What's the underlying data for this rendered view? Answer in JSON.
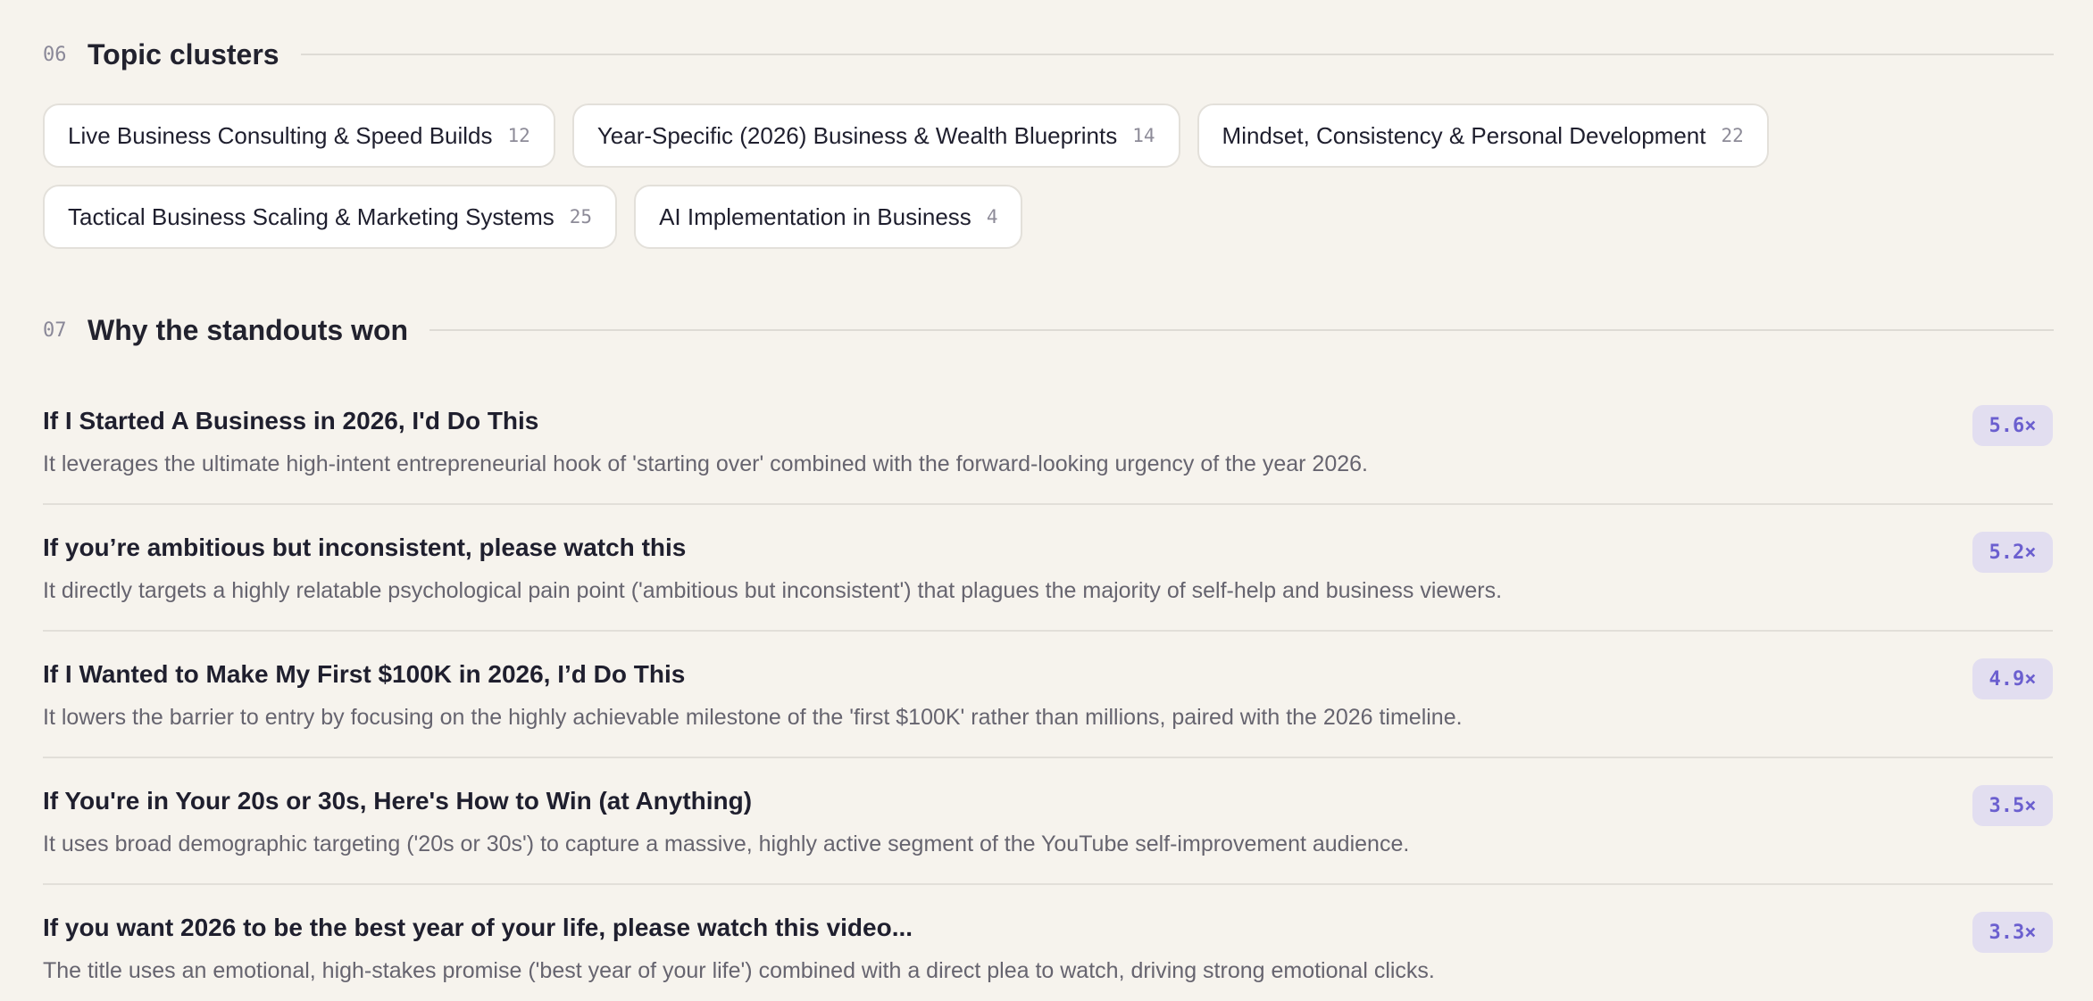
{
  "sections": {
    "topics": {
      "number": "06",
      "title": "Topic clusters",
      "clusters": [
        {
          "label": "Live Business Consulting & Speed Builds",
          "count": "12"
        },
        {
          "label": "Year-Specific (2026) Business & Wealth Blueprints",
          "count": "14"
        },
        {
          "label": "Mindset, Consistency & Personal Development",
          "count": "22"
        },
        {
          "label": "Tactical Business Scaling & Marketing Systems",
          "count": "25"
        },
        {
          "label": "AI Implementation in Business",
          "count": "4"
        }
      ]
    },
    "standouts": {
      "number": "07",
      "title": "Why the standouts won",
      "items": [
        {
          "title": "If I Started A Business in 2026, I'd Do This",
          "reason": "It leverages the ultimate high-intent entrepreneurial hook of 'starting over' combined with the forward-looking urgency of the year 2026.",
          "multiplier": "5.6×"
        },
        {
          "title": "If you’re ambitious but inconsistent, please watch this",
          "reason": "It directly targets a highly relatable psychological pain point ('ambitious but inconsistent') that plagues the majority of self-help and business viewers.",
          "multiplier": "5.2×"
        },
        {
          "title": "If I Wanted to Make My First $100K in 2026, I’d Do This",
          "reason": "It lowers the barrier to entry by focusing on the highly achievable milestone of the 'first $100K' rather than millions, paired with the 2026 timeline.",
          "multiplier": "4.9×"
        },
        {
          "title": "If You're in Your 20s or 30s, Here's How to Win (at Anything)",
          "reason": "It uses broad demographic targeting ('20s or 30s') to capture a massive, highly active segment of the YouTube self-improvement audience.",
          "multiplier": "3.5×"
        },
        {
          "title": "If you want 2026 to be the best year of your life, please watch this video...",
          "reason": "The title uses an emotional, high-stakes promise ('best year of your life') combined with a direct plea to watch, driving strong emotional clicks.",
          "multiplier": "3.3×"
        }
      ]
    }
  },
  "colors": {
    "background": "#f6f3ed",
    "badge_bg": "#e2def0",
    "badge_text": "#6b5fcf"
  }
}
